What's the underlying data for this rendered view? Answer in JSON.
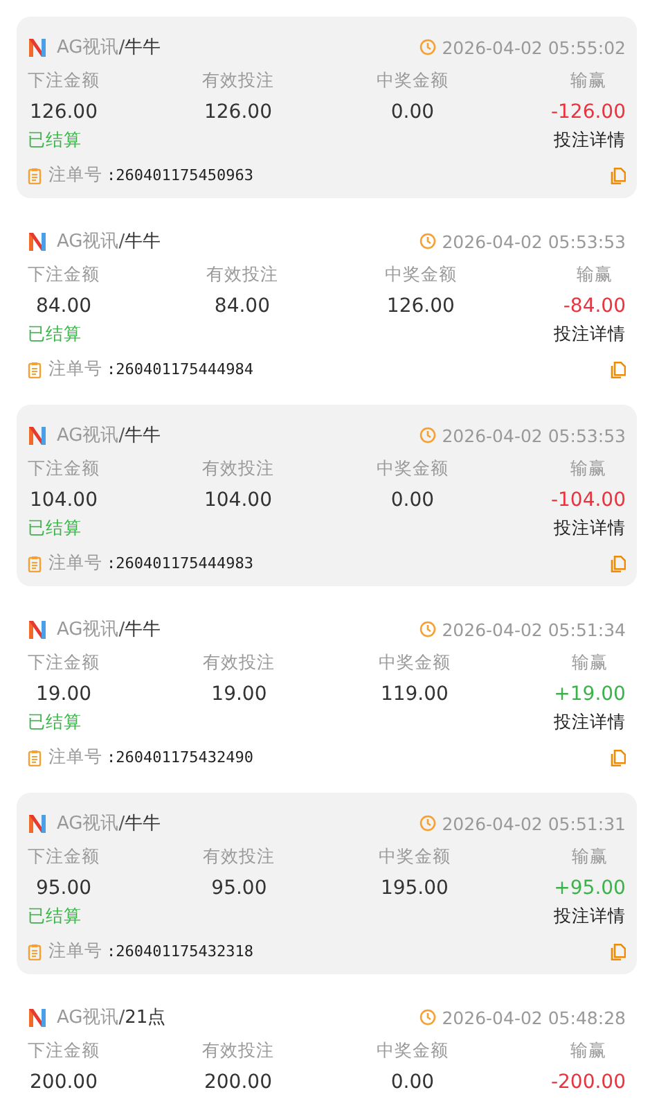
{
  "bets": [
    {
      "shaded": true,
      "platform": "AG视讯",
      "separator": "/",
      "game": "牛牛",
      "time": "2026-04-02 05:55:02",
      "labels": [
        "下注金额",
        "有效投注",
        "中奖金额",
        "输赢"
      ],
      "stake": "126.00",
      "valid": "126.00",
      "payout": "0.00",
      "result": "-126.00",
      "won": false,
      "status": "已结算",
      "settled": true,
      "detail_link": "投注详情",
      "order_label": "注单号",
      "order_no": ":260401175450963"
    },
    {
      "shaded": false,
      "platform": "AG视讯",
      "separator": "/",
      "game": "牛牛",
      "time": "2026-04-02 05:53:53",
      "labels": [
        "下注金额",
        "有效投注",
        "中奖金额",
        "输赢"
      ],
      "stake": "84.00",
      "valid": "84.00",
      "payout": "126.00",
      "result": "-84.00",
      "won": false,
      "status": "已结算",
      "settled": true,
      "detail_link": "投注详情",
      "order_label": "注单号",
      "order_no": ":260401175444984"
    },
    {
      "shaded": true,
      "platform": "AG视讯",
      "separator": "/",
      "game": "牛牛",
      "time": "2026-04-02 05:53:53",
      "labels": [
        "下注金额",
        "有效投注",
        "中奖金额",
        "输赢"
      ],
      "stake": "104.00",
      "valid": "104.00",
      "payout": "0.00",
      "result": "-104.00",
      "won": false,
      "status": "已结算",
      "settled": true,
      "detail_link": "投注详情",
      "order_label": "注单号",
      "order_no": ":260401175444983"
    },
    {
      "shaded": false,
      "platform": "AG视讯",
      "separator": "/",
      "game": "牛牛",
      "time": "2026-04-02 05:51:34",
      "labels": [
        "下注金额",
        "有效投注",
        "中奖金额",
        "输赢"
      ],
      "stake": "19.00",
      "valid": "19.00",
      "payout": "119.00",
      "result": "+19.00",
      "won": true,
      "status": "已结算",
      "settled": true,
      "detail_link": "投注详情",
      "order_label": "注单号",
      "order_no": ":260401175432490"
    },
    {
      "shaded": true,
      "platform": "AG视讯",
      "separator": "/",
      "game": "牛牛",
      "time": "2026-04-02 05:51:31",
      "labels": [
        "下注金额",
        "有效投注",
        "中奖金额",
        "输赢"
      ],
      "stake": "95.00",
      "valid": "95.00",
      "payout": "195.00",
      "result": "+95.00",
      "won": true,
      "status": "已结算",
      "settled": true,
      "detail_link": "投注详情",
      "order_label": "注单号",
      "order_no": ":260401175432318"
    },
    {
      "shaded": false,
      "platform": "AG视讯",
      "separator": "/",
      "game": "21点",
      "time": "2026-04-02 05:48:28",
      "labels": [
        "下注金额",
        "有效投注",
        "中奖金额",
        "输赢"
      ],
      "stake": "200.00",
      "valid": "200.00",
      "payout": "0.00",
      "result": "-200.00",
      "won": false
    }
  ]
}
